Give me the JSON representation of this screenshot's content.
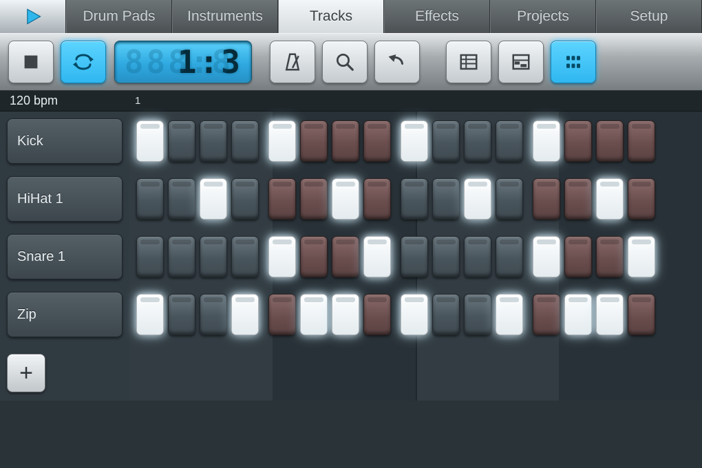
{
  "nav": {
    "tabs": [
      {
        "label": "Drum Pads",
        "active": false
      },
      {
        "label": "Instruments",
        "active": false
      },
      {
        "label": "Tracks",
        "active": true
      },
      {
        "label": "Effects",
        "active": false
      },
      {
        "label": "Projects",
        "active": false
      },
      {
        "label": "Setup",
        "active": false
      }
    ]
  },
  "toolbar": {
    "stop_icon": "stop",
    "loop_icon": "loop",
    "metronome_icon": "metronome",
    "zoom_icon": "search",
    "undo_icon": "undo",
    "view_song_icon": "song-view",
    "view_piano_icon": "piano-roll-view",
    "view_step_icon": "step-view",
    "loop_active": true,
    "step_view_active": true,
    "lcd_ghost": "888:8",
    "lcd_value": "1:3"
  },
  "tempo": {
    "label": "120 bpm"
  },
  "ruler": {
    "start": "1"
  },
  "tracks": [
    {
      "name": "Kick",
      "steps": [
        1,
        0,
        0,
        0,
        1,
        0,
        0,
        0,
        1,
        0,
        0,
        0,
        1,
        0,
        0,
        0
      ]
    },
    {
      "name": "HiHat 1",
      "steps": [
        0,
        0,
        1,
        0,
        0,
        0,
        1,
        0,
        0,
        0,
        1,
        0,
        0,
        0,
        1,
        0
      ]
    },
    {
      "name": "Snare 1",
      "steps": [
        0,
        0,
        0,
        0,
        1,
        0,
        0,
        1,
        0,
        0,
        0,
        0,
        1,
        0,
        0,
        1
      ]
    },
    {
      "name": "Zip",
      "steps": [
        1,
        0,
        0,
        1,
        0,
        1,
        1,
        0,
        1,
        0,
        0,
        1,
        0,
        1,
        1,
        0
      ]
    }
  ],
  "add_label": "+"
}
